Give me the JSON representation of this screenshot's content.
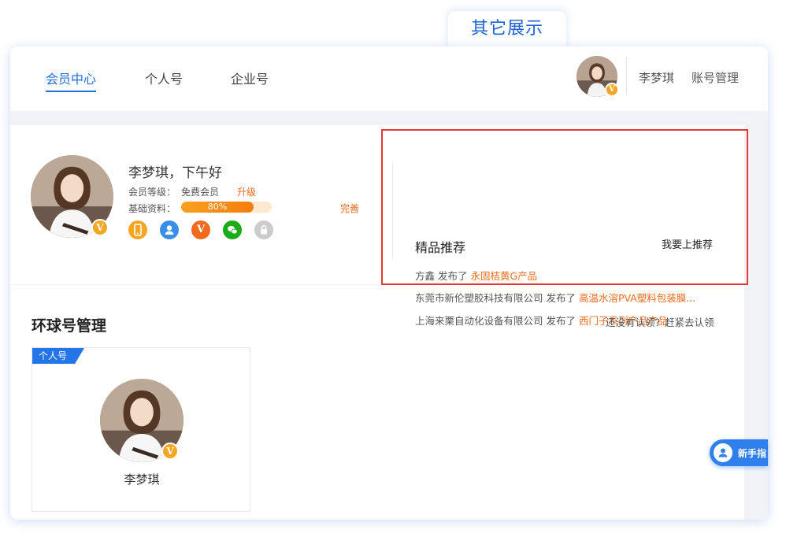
{
  "top_tab": {
    "label": "其它展示"
  },
  "nav": {
    "tabs": [
      {
        "label": "会员中心",
        "active": true
      },
      {
        "label": "个人号",
        "active": false
      },
      {
        "label": "企业号",
        "active": false
      }
    ],
    "user_name": "李梦琪",
    "account_manage": "账号管理"
  },
  "profile": {
    "greeting": "李梦琪，下午好",
    "level_label": "会员等级：",
    "level_value": "免费会员",
    "upgrade": "升级",
    "info_label": "基础资料：",
    "progress_percent": 80,
    "progress_text": "80%",
    "complete": "完善",
    "icons": [
      {
        "name": "phone-icon",
        "color": "#f5a623"
      },
      {
        "name": "user-icon",
        "color": "#3a8ee6"
      },
      {
        "name": "vip-icon",
        "color": "#f26b1d"
      },
      {
        "name": "wechat-icon",
        "color": "#1aad19"
      },
      {
        "name": "lock-icon",
        "color": "#cccccc"
      }
    ]
  },
  "recommend": {
    "title": "精品推荐",
    "action": "我要上推荐",
    "items": [
      {
        "company": "方鑫",
        "verb": " 发布了 ",
        "product": "永固桔黄G产品"
      },
      {
        "company": "东莞市新伦塑胶科技有限公司",
        "verb": " 发布了 ",
        "product": "高温水溶PVA塑料包装膜..."
      },
      {
        "company": "上海来栗自动化设备有限公司",
        "verb": " 发布了 ",
        "product": "西门子系列产品产品"
      }
    ]
  },
  "management": {
    "title": "环球号管理",
    "hint": "还没有认领？赶紧去认领",
    "card": {
      "tag": "个人号",
      "name": "李梦琪"
    }
  },
  "helper": {
    "label": "新手指"
  },
  "colors": {
    "accent": "#1f6fdc",
    "orange": "#f26b1d",
    "highlight_border": "#e53935"
  }
}
